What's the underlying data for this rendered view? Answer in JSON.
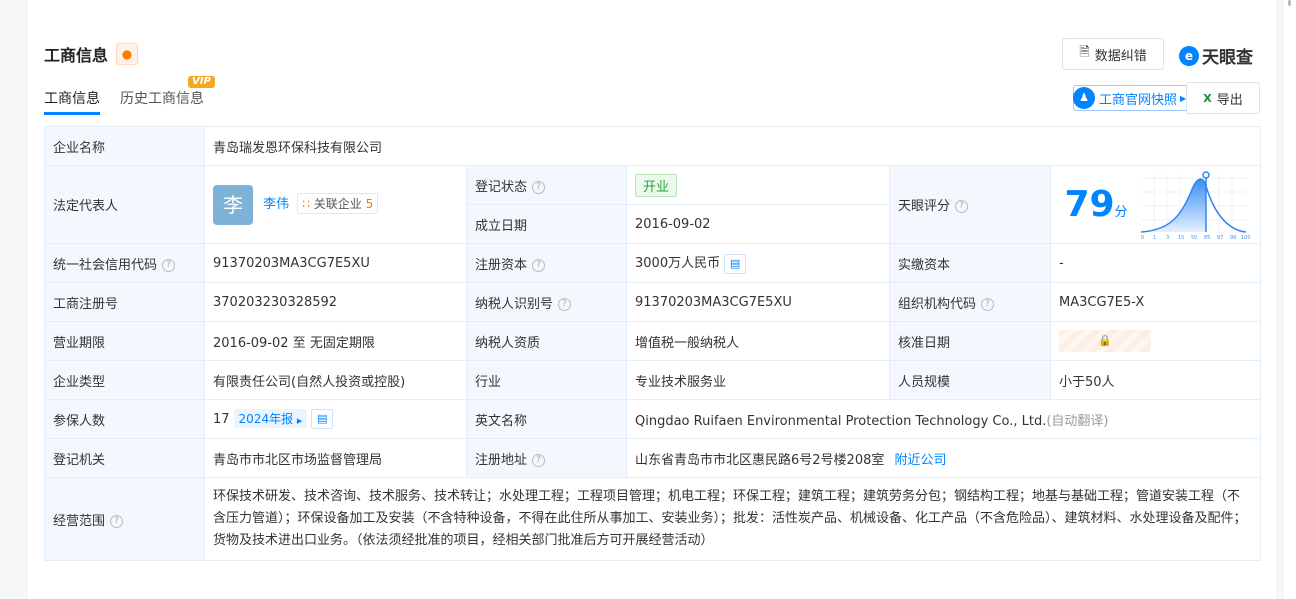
{
  "header": {
    "title": "工商信息",
    "data_fix": "数据纠错",
    "brand": "天眼查",
    "snapshot": "工商官网快照",
    "export": "导出"
  },
  "tabs": [
    {
      "label": "工商信息"
    },
    {
      "label": "历史工商信息",
      "badge": "VIP"
    }
  ],
  "rows": {
    "company_name": {
      "label": "企业名称",
      "value": "青岛瑞发恩环保科技有限公司"
    },
    "legal_rep": {
      "label": "法定代表人",
      "avatar": "李",
      "name": "李伟",
      "related_label": "关联企业",
      "related_count": "5"
    },
    "status": {
      "label": "登记状态",
      "value": "开业"
    },
    "founded": {
      "label": "成立日期",
      "value": "2016-09-02"
    },
    "tianyan_score": {
      "label": "天眼评分",
      "value": "79",
      "unit": "分",
      "axis": [
        "0",
        "1",
        "3",
        "15",
        "50",
        "85",
        "97",
        "99",
        "100"
      ]
    },
    "credit_code": {
      "label": "统一社会信用代码",
      "value": "91370203MA3CG7E5XU"
    },
    "reg_capital": {
      "label": "注册资本",
      "value": "3000万人民币"
    },
    "paid_capital": {
      "label": "实缴资本",
      "value": "-"
    },
    "reg_no": {
      "label": "工商注册号",
      "value": "370203230328592"
    },
    "taxpayer_id": {
      "label": "纳税人识别号",
      "value": "91370203MA3CG7E5XU"
    },
    "org_code": {
      "label": "组织机构代码",
      "value": "MA3CG7E5-X"
    },
    "term": {
      "label": "营业期限",
      "value": "2016-09-02 至 无固定期限"
    },
    "taxpayer_qual": {
      "label": "纳税人资质",
      "value": "增值税一般纳税人"
    },
    "approval_date": {
      "label": "核准日期"
    },
    "type": {
      "label": "企业类型",
      "value": "有限责任公司(自然人投资或控股)"
    },
    "industry": {
      "label": "行业",
      "value": "专业技术服务业"
    },
    "staff_size": {
      "label": "人员规模",
      "value": "小于50人"
    },
    "insured": {
      "label": "参保人数",
      "value": "17",
      "report": "2024年报"
    },
    "english_name": {
      "label": "英文名称",
      "value": "Qingdao Ruifaen Environmental Protection Technology Co., Ltd.",
      "note": "(自动翻译)"
    },
    "authority": {
      "label": "登记机关",
      "value": "青岛市市北区市场监督管理局"
    },
    "address": {
      "label": "注册地址",
      "value": "山东省青岛市市北区惠民路6号2号楼208室",
      "nearby": "附近公司"
    },
    "scope": {
      "label": "经营范围",
      "value": "环保技术研发、技术咨询、技术服务、技术转让；水处理工程；工程项目管理；机电工程；环保工程；建筑工程；建筑劳务分包；钢结构工程；地基与基础工程；管道安装工程（不含压力管道）；环保设备加工及安装（不含特种设备，不得在此住所从事加工、安装业务）；批发：活性炭产品、机械设备、化工产品（不含危险品）、建筑材料、水处理设备及配件；货物及技术进出口业务。（依法须经批准的项目，经相关部门批准后方可开展经营活动）"
    }
  }
}
